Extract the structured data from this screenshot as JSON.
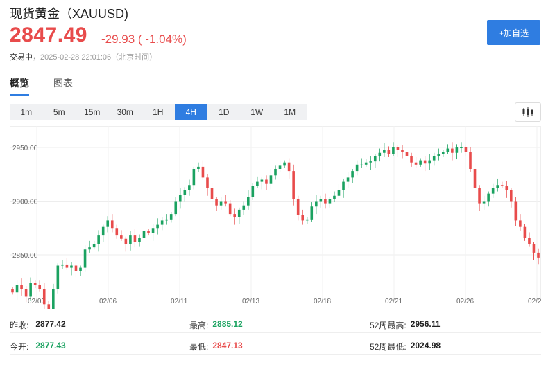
{
  "header": {
    "title": "现货黄金（XAUUSD)",
    "price": "2847.49",
    "change": "-29.93 ( -1.04%)",
    "status_label": "交易中",
    "timestamp": "，2025-02-28 22:01:06（北京时间）",
    "add_watchlist_label": "+加自选"
  },
  "tabs": [
    {
      "label": "概览",
      "active": true
    },
    {
      "label": "图表",
      "active": false
    }
  ],
  "periods": [
    {
      "label": "1m",
      "active": false
    },
    {
      "label": "5m",
      "active": false
    },
    {
      "label": "15m",
      "active": false
    },
    {
      "label": "30m",
      "active": false
    },
    {
      "label": "1H",
      "active": false
    },
    {
      "label": "4H",
      "active": true
    },
    {
      "label": "1D",
      "active": false
    },
    {
      "label": "1W",
      "active": false
    },
    {
      "label": "1M",
      "active": false
    }
  ],
  "chart_icon": "candlestick-icon",
  "colors": {
    "up": "#1aa260",
    "down": "#e84b4b",
    "accent": "#2f7de1"
  },
  "chart_data": {
    "type": "candlestick",
    "y_ticks": [
      "2950.00",
      "2900.00",
      "2850.00"
    ],
    "x_ticks": [
      "02/03",
      "02/06",
      "02/11",
      "02/13",
      "02/18",
      "02/21",
      "02/26",
      "02/2"
    ],
    "ylim": [
      2810,
      2970
    ],
    "grid": true,
    "closes": [
      2815,
      2822,
      2818,
      2811,
      2824,
      2822,
      2818,
      2804,
      2796,
      2818,
      2840,
      2841,
      2838,
      2840,
      2835,
      2838,
      2855,
      2857,
      2860,
      2868,
      2876,
      2882,
      2875,
      2868,
      2865,
      2860,
      2868,
      2862,
      2866,
      2872,
      2870,
      2875,
      2878,
      2882,
      2883,
      2888,
      2900,
      2906,
      2910,
      2915,
      2930,
      2932,
      2922,
      2912,
      2902,
      2896,
      2900,
      2898,
      2888,
      2885,
      2892,
      2896,
      2904,
      2914,
      2918,
      2920,
      2916,
      2924,
      2930,
      2933,
      2936,
      2928,
      2902,
      2887,
      2882,
      2883,
      2895,
      2900,
      2902,
      2898,
      2902,
      2905,
      2910,
      2918,
      2922,
      2928,
      2934,
      2934,
      2936,
      2937,
      2942,
      2945,
      2948,
      2944,
      2950,
      2948,
      2946,
      2942,
      2936,
      2934,
      2938,
      2935,
      2938,
      2942,
      2944,
      2946,
      2949,
      2945,
      2950,
      2950,
      2946,
      2930,
      2912,
      2898,
      2900,
      2907,
      2912,
      2915,
      2914,
      2910,
      2900,
      2882,
      2876,
      2866,
      2860,
      2852,
      2847.49
    ]
  },
  "stats": {
    "prev_close_label": "昨收:",
    "prev_close": "2877.42",
    "open_label": "今开:",
    "open": "2877.43",
    "high_label": "最高:",
    "high": "2885.12",
    "low_label": "最低:",
    "low": "2847.13",
    "week52_high_label": "52周最高:",
    "week52_high": "2956.11",
    "week52_low_label": "52周最低:",
    "week52_low": "2024.98"
  }
}
